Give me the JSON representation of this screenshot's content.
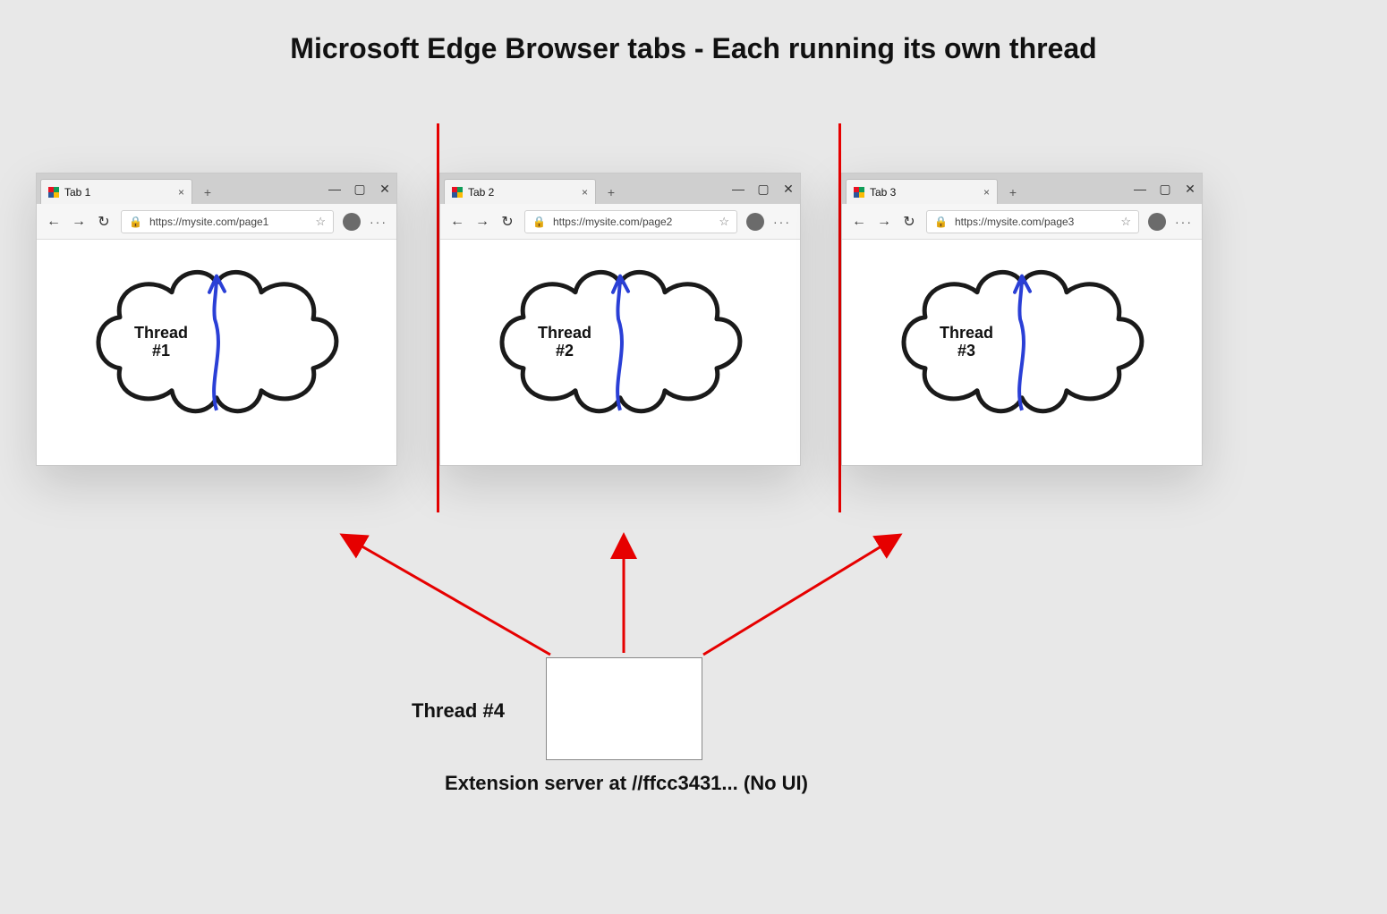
{
  "title": "Microsoft Edge Browser tabs - Each running its own thread",
  "tabs": [
    {
      "label": "Tab 1",
      "url": "https://mysite.com/page1",
      "thread_line1": "Thread",
      "thread_line2": "#1"
    },
    {
      "label": "Tab 2",
      "url": "https://mysite.com/page2",
      "thread_line1": "Thread",
      "thread_line2": "#2"
    },
    {
      "label": "Tab 3",
      "url": "https://mysite.com/page3",
      "thread_line1": "Thread",
      "thread_line2": "#3"
    }
  ],
  "thread4_label": "Thread #4",
  "extension_caption": "Extension server at //ffcc3431... (No UI)",
  "icons": {
    "close_tab": "×",
    "new_tab": "+",
    "win_min": "—",
    "win_max": "▢",
    "win_close": "✕",
    "back": "←",
    "forward": "→",
    "refresh": "↻",
    "lock": "🔒",
    "star": "☆",
    "more": "···"
  },
  "colors": {
    "accent_red": "#e60000",
    "thread_arrow": "#2a3fd6"
  }
}
